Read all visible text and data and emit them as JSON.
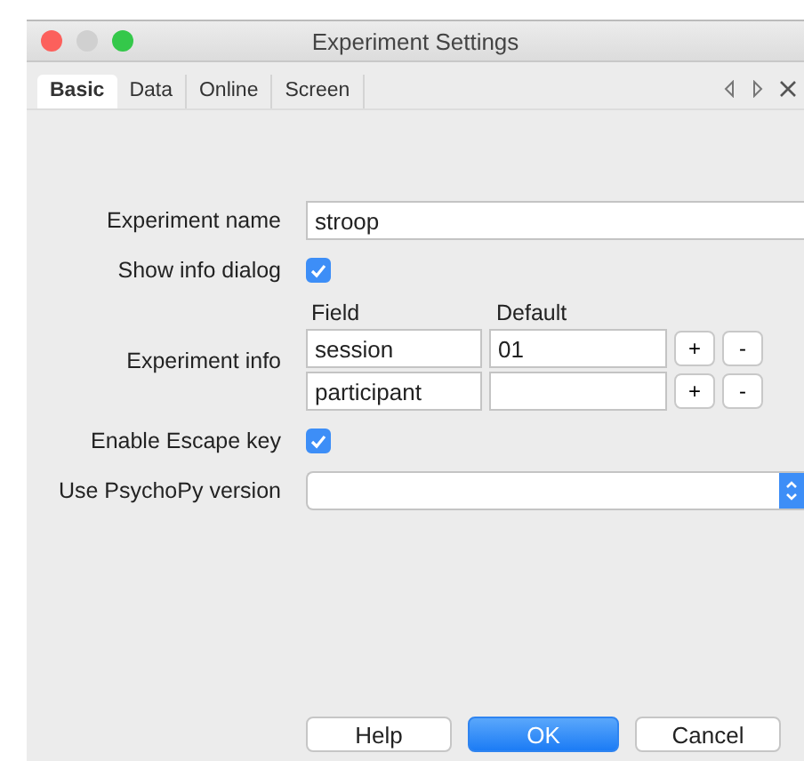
{
  "window": {
    "title": "Experiment Settings"
  },
  "tabs": [
    {
      "label": "Basic",
      "selected": true
    },
    {
      "label": "Data",
      "selected": false
    },
    {
      "label": "Online",
      "selected": false
    },
    {
      "label": "Screen",
      "selected": false
    }
  ],
  "rows": [
    {
      "kind": "text",
      "label": "Experiment name",
      "value": "stroop"
    },
    {
      "kind": "checkbox",
      "label": "Show info dialog",
      "checked": true
    },
    {
      "kind": "table",
      "label": "Experiment info",
      "columns": [
        "Field",
        "Default"
      ],
      "entries": [
        {
          "field": "session",
          "default": "01",
          "add": "+",
          "remove": "-"
        },
        {
          "field": "participant",
          "add": "+",
          "remove": "-"
        }
      ]
    },
    {
      "kind": "checkbox",
      "label": "Enable Escape key",
      "checked": true
    },
    {
      "kind": "select",
      "label": "Use PsychoPy version"
    }
  ],
  "buttons": [
    {
      "label": "Help",
      "kind": "normal"
    },
    {
      "label": "OK",
      "kind": "default"
    },
    {
      "label": "Cancel",
      "kind": "normal"
    }
  ]
}
